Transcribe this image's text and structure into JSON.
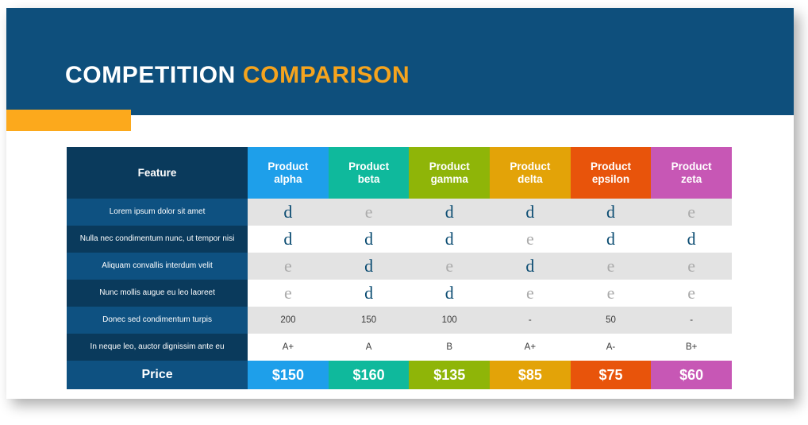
{
  "slide": {
    "title_part1": "COMPETITION",
    "title_part2": "COMPARISON",
    "colors": {
      "navy_header": "#0E4F7C",
      "accent_orange": "#FCA91C",
      "title_orange": "#F5A41E",
      "feature_head": "#0A3A5C",
      "row_blue": "#0E5181",
      "row_navy": "#0A3A5C",
      "row_gray": "#E3E3E3",
      "row_white": "#FFFFFF",
      "mark_yes": "#0B4C72",
      "mark_no": "#ABABAB"
    }
  },
  "table": {
    "feature_header": "Feature",
    "columns": [
      {
        "name": "Product alpha",
        "line1": "Product",
        "line2": "alpha",
        "color": "#1E9FEA"
      },
      {
        "name": "Product beta",
        "line1": "Product",
        "line2": "beta",
        "color": "#0FB99C"
      },
      {
        "name": "Product gamma",
        "line1": "Product",
        "line2": "gamma",
        "color": "#8FB508"
      },
      {
        "name": "Product delta",
        "line1": "Product",
        "line2": "delta",
        "color": "#E3A308"
      },
      {
        "name": "Product epsilon",
        "line1": "Product",
        "line2": "epsilon",
        "color": "#E8540B"
      },
      {
        "name": "Product zeta",
        "line1": "Product",
        "line2": "zeta",
        "color": "#C757B5"
      }
    ],
    "rows": [
      {
        "feature": "Lorem ipsum dolor sit amet",
        "type": "mark",
        "values": [
          "d",
          "e",
          "d",
          "d",
          "d",
          "e"
        ]
      },
      {
        "feature": "Nulla nec condimentum nunc, ut tempor nisi",
        "type": "mark",
        "values": [
          "d",
          "d",
          "d",
          "e",
          "d",
          "d"
        ]
      },
      {
        "feature": "Aliquam convallis interdum velit",
        "type": "mark",
        "values": [
          "e",
          "d",
          "e",
          "d",
          "e",
          "e"
        ]
      },
      {
        "feature": "Nunc mollis augue eu leo laoreet",
        "type": "mark",
        "values": [
          "e",
          "d",
          "d",
          "e",
          "e",
          "e"
        ]
      },
      {
        "feature": "Donec sed condimentum turpis",
        "type": "text",
        "values": [
          "200",
          "150",
          "100",
          "-",
          "50",
          "-"
        ]
      },
      {
        "feature": "In neque leo, auctor dignissim ante eu",
        "type": "text",
        "values": [
          "A+",
          "A",
          "B",
          "A+",
          "A-",
          "B+"
        ]
      }
    ],
    "price_row": {
      "label": "Price",
      "values": [
        "$150",
        "$160",
        "$135",
        "$85",
        "$75",
        "$60"
      ]
    }
  }
}
